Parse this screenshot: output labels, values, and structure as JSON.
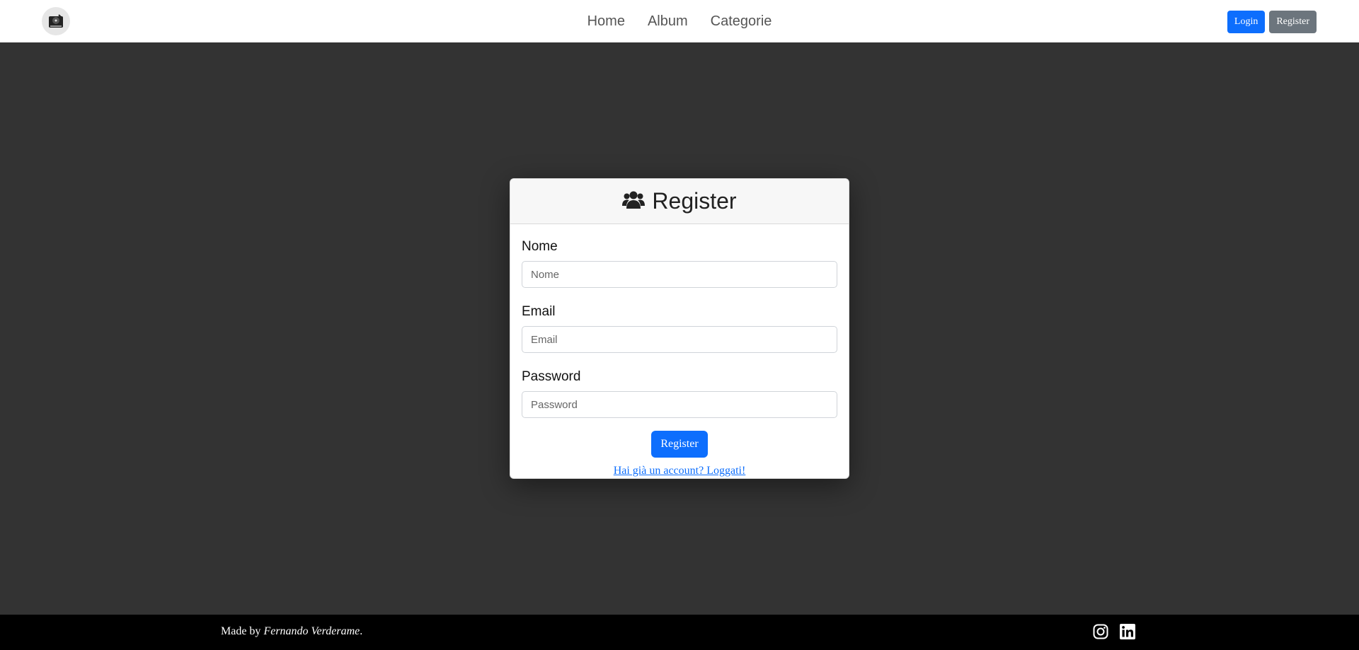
{
  "navbar": {
    "logo_icon": "vinyl-record-icon",
    "links": [
      {
        "label": "Home"
      },
      {
        "label": "Album"
      },
      {
        "label": "Categorie"
      }
    ],
    "login_label": "Login",
    "register_label": "Register",
    "colors": {
      "primary": "#0d6efd",
      "secondary": "#6c757d"
    }
  },
  "card": {
    "title_icon": "users-icon",
    "title": "Register",
    "fields": [
      {
        "label": "Nome",
        "placeholder": "Nome",
        "value": ""
      },
      {
        "label": "Email",
        "placeholder": "Email",
        "value": ""
      },
      {
        "label": "Password",
        "placeholder": "Password",
        "value": ""
      }
    ],
    "submit_label": "Register",
    "login_link": "Hai già un account? Loggati!"
  },
  "footer": {
    "made_by_prefix": "Made by ",
    "author": "Fernando Verderame",
    "suffix": ".",
    "icons": [
      "instagram-icon",
      "linkedin-icon"
    ]
  },
  "colors": {
    "page_background": "#333333",
    "footer_background": "#000000",
    "link": "#0d6efd"
  }
}
